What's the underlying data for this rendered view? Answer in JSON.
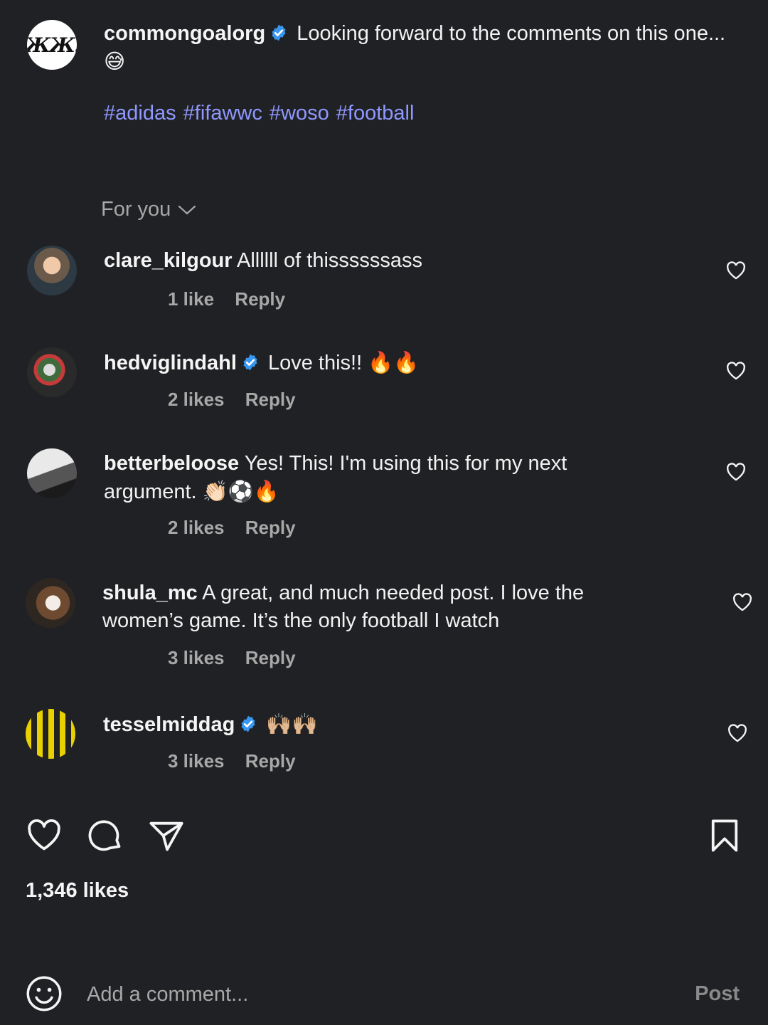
{
  "caption": {
    "username": "commongoalorg",
    "logo_text": "ЖЖ.",
    "text": "Looking forward to the comments on this one...",
    "emoji": "😅",
    "hashtags": "#adidas #fifawwc #woso #football"
  },
  "sort": {
    "label": "For you"
  },
  "comments": [
    {
      "username": "clare_kilgour",
      "verified": false,
      "text": "Allllll of thissssssass",
      "emoji": "",
      "likes": "1 like",
      "reply": "Reply"
    },
    {
      "username": "hedviglindahl",
      "verified": true,
      "text": "Love this!!",
      "emoji": "🔥🔥",
      "likes": "2 likes",
      "reply": "Reply"
    },
    {
      "username": "betterbeloose",
      "verified": false,
      "text": "Yes! This! I'm using this for my next argument.",
      "emoji": "👏🏻⚽🔥",
      "likes": "2 likes",
      "reply": "Reply"
    },
    {
      "username": "shula_mc",
      "verified": false,
      "text": "A great, and much needed post. I love the women’s game. It’s the only football I watch",
      "emoji": "",
      "likes": "3 likes",
      "reply": "Reply"
    },
    {
      "username": "tesselmiddag",
      "verified": true,
      "text": "",
      "emoji": "🙌🏼🙌🏼",
      "likes": "3 likes",
      "reply": "Reply"
    }
  ],
  "actions": {
    "like_icon": "heart-icon",
    "comment_icon": "comment-bubble-icon",
    "share_icon": "paper-plane-icon",
    "save_icon": "bookmark-icon"
  },
  "likes_count": "1,346 likes",
  "comment_bar": {
    "placeholder": "Add a comment...",
    "post_label": "Post"
  },
  "colors": {
    "background": "#202124",
    "hashtag": "#8f98ff",
    "verified": "#3897f0",
    "muted": "#a8a8a8"
  }
}
